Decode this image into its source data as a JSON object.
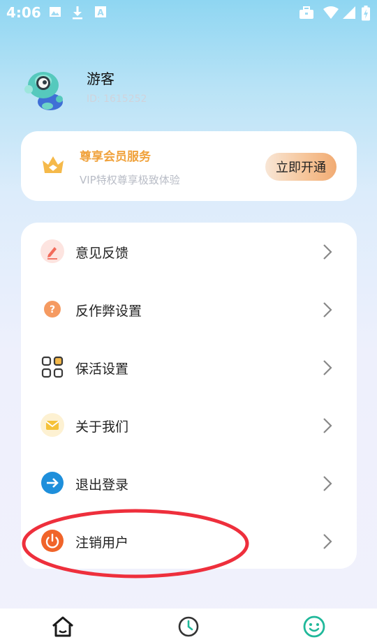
{
  "status_bar": {
    "time": "4:06",
    "left_icons": [
      "image-icon",
      "download-icon",
      "font-icon"
    ],
    "right_icons": [
      "briefcase-icon",
      "wifi-icon",
      "signal-icon",
      "battery-icon"
    ]
  },
  "profile": {
    "name": "游客",
    "id": "ID: 1615252"
  },
  "vip": {
    "title": "尊享会员服务",
    "subtitle": "VIP特权尊享极致体验",
    "button_label": "立即开通",
    "title_color": "#f0a23c",
    "icon": "crown-icon"
  },
  "menu": {
    "items": [
      {
        "label": "意见反馈",
        "icon": "feedback-pen-icon",
        "color": "#f26b5b"
      },
      {
        "label": "反作弊设置",
        "icon": "question-icon",
        "color": "#f59a61"
      },
      {
        "label": "保活设置",
        "icon": "grid-icon",
        "color": "#3a3a3a"
      },
      {
        "label": "关于我们",
        "icon": "envelope-icon",
        "color": "#f5c23a"
      },
      {
        "label": "退出登录",
        "icon": "arrow-right-icon",
        "color": "#1e8fdb"
      },
      {
        "label": "注销用户",
        "icon": "power-icon",
        "color": "#f0642a"
      }
    ]
  },
  "bottom_nav": {
    "items": [
      {
        "icon": "home-icon",
        "active": false
      },
      {
        "icon": "clock-icon",
        "active": false
      },
      {
        "icon": "smile-icon",
        "active": true
      }
    ],
    "active_color": "#20b89a"
  }
}
